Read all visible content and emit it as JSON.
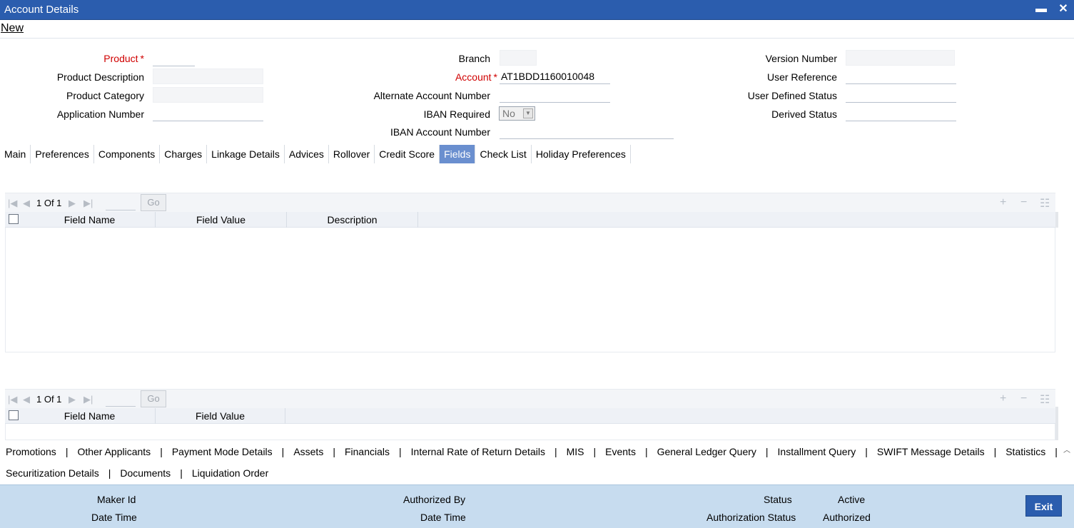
{
  "window": {
    "title": "Account Details",
    "minimize": "▬",
    "close": "✕"
  },
  "toolbar": {
    "new_label": "New"
  },
  "form": {
    "product": {
      "label": "Product",
      "required": "*",
      "value": ""
    },
    "product_description": {
      "label": "Product Description",
      "value": ""
    },
    "product_category": {
      "label": "Product Category",
      "value": ""
    },
    "application_number": {
      "label": "Application Number",
      "value": ""
    },
    "branch": {
      "label": "Branch",
      "value": ""
    },
    "account": {
      "label": "Account",
      "required": "*",
      "value": "AT1BDD1160010048"
    },
    "alternate_account_number": {
      "label": "Alternate Account Number",
      "value": ""
    },
    "iban_required": {
      "label": "IBAN Required",
      "value": "No"
    },
    "iban_account_number": {
      "label": "IBAN Account Number",
      "value": ""
    },
    "version_number": {
      "label": "Version Number",
      "value": ""
    },
    "user_reference": {
      "label": "User Reference",
      "value": ""
    },
    "user_defined_status": {
      "label": "User Defined Status",
      "value": ""
    },
    "derived_status": {
      "label": "Derived Status",
      "value": ""
    }
  },
  "tabs": [
    "Main",
    "Preferences",
    "Components",
    "Charges",
    "Linkage Details",
    "Advices",
    "Rollover",
    "Credit Score",
    "Fields",
    "Check List",
    "Holiday Preferences"
  ],
  "active_tab": "Fields",
  "grid1": {
    "pager_text": "1 Of 1",
    "go_label": "Go",
    "columns": [
      "Field Name",
      "Field Value",
      "Description"
    ]
  },
  "grid2": {
    "pager_text": "1 Of 1",
    "go_label": "Go",
    "columns": [
      "Field Name",
      "Field Value"
    ]
  },
  "footer_links": {
    "row1": [
      "Promotions",
      "Other Applicants",
      "Payment Mode Details",
      "Assets",
      "Financials",
      "Internal Rate of Return Details",
      "MIS",
      "Events",
      "General Ledger Query",
      "Installment Query",
      "SWIFT Message Details",
      "Statistics"
    ],
    "row2": [
      "Securitization Details",
      "Documents",
      "Liquidation Order"
    ],
    "separator": "|"
  },
  "status": {
    "maker_id_label": "Maker Id",
    "date_time_label": "Date Time",
    "authorized_by_label": "Authorized By",
    "checker_date_time_label": "Date Time",
    "status_label": "Status",
    "status_value": "Active",
    "authorization_status_label": "Authorization Status",
    "authorization_status_value": "Authorized"
  },
  "exit_label": "Exit",
  "colors": {
    "titlebar": "#2b5dae",
    "active_tab": "#6a8fcf",
    "statusbar": "#c7dcef",
    "required": "#d00000"
  }
}
